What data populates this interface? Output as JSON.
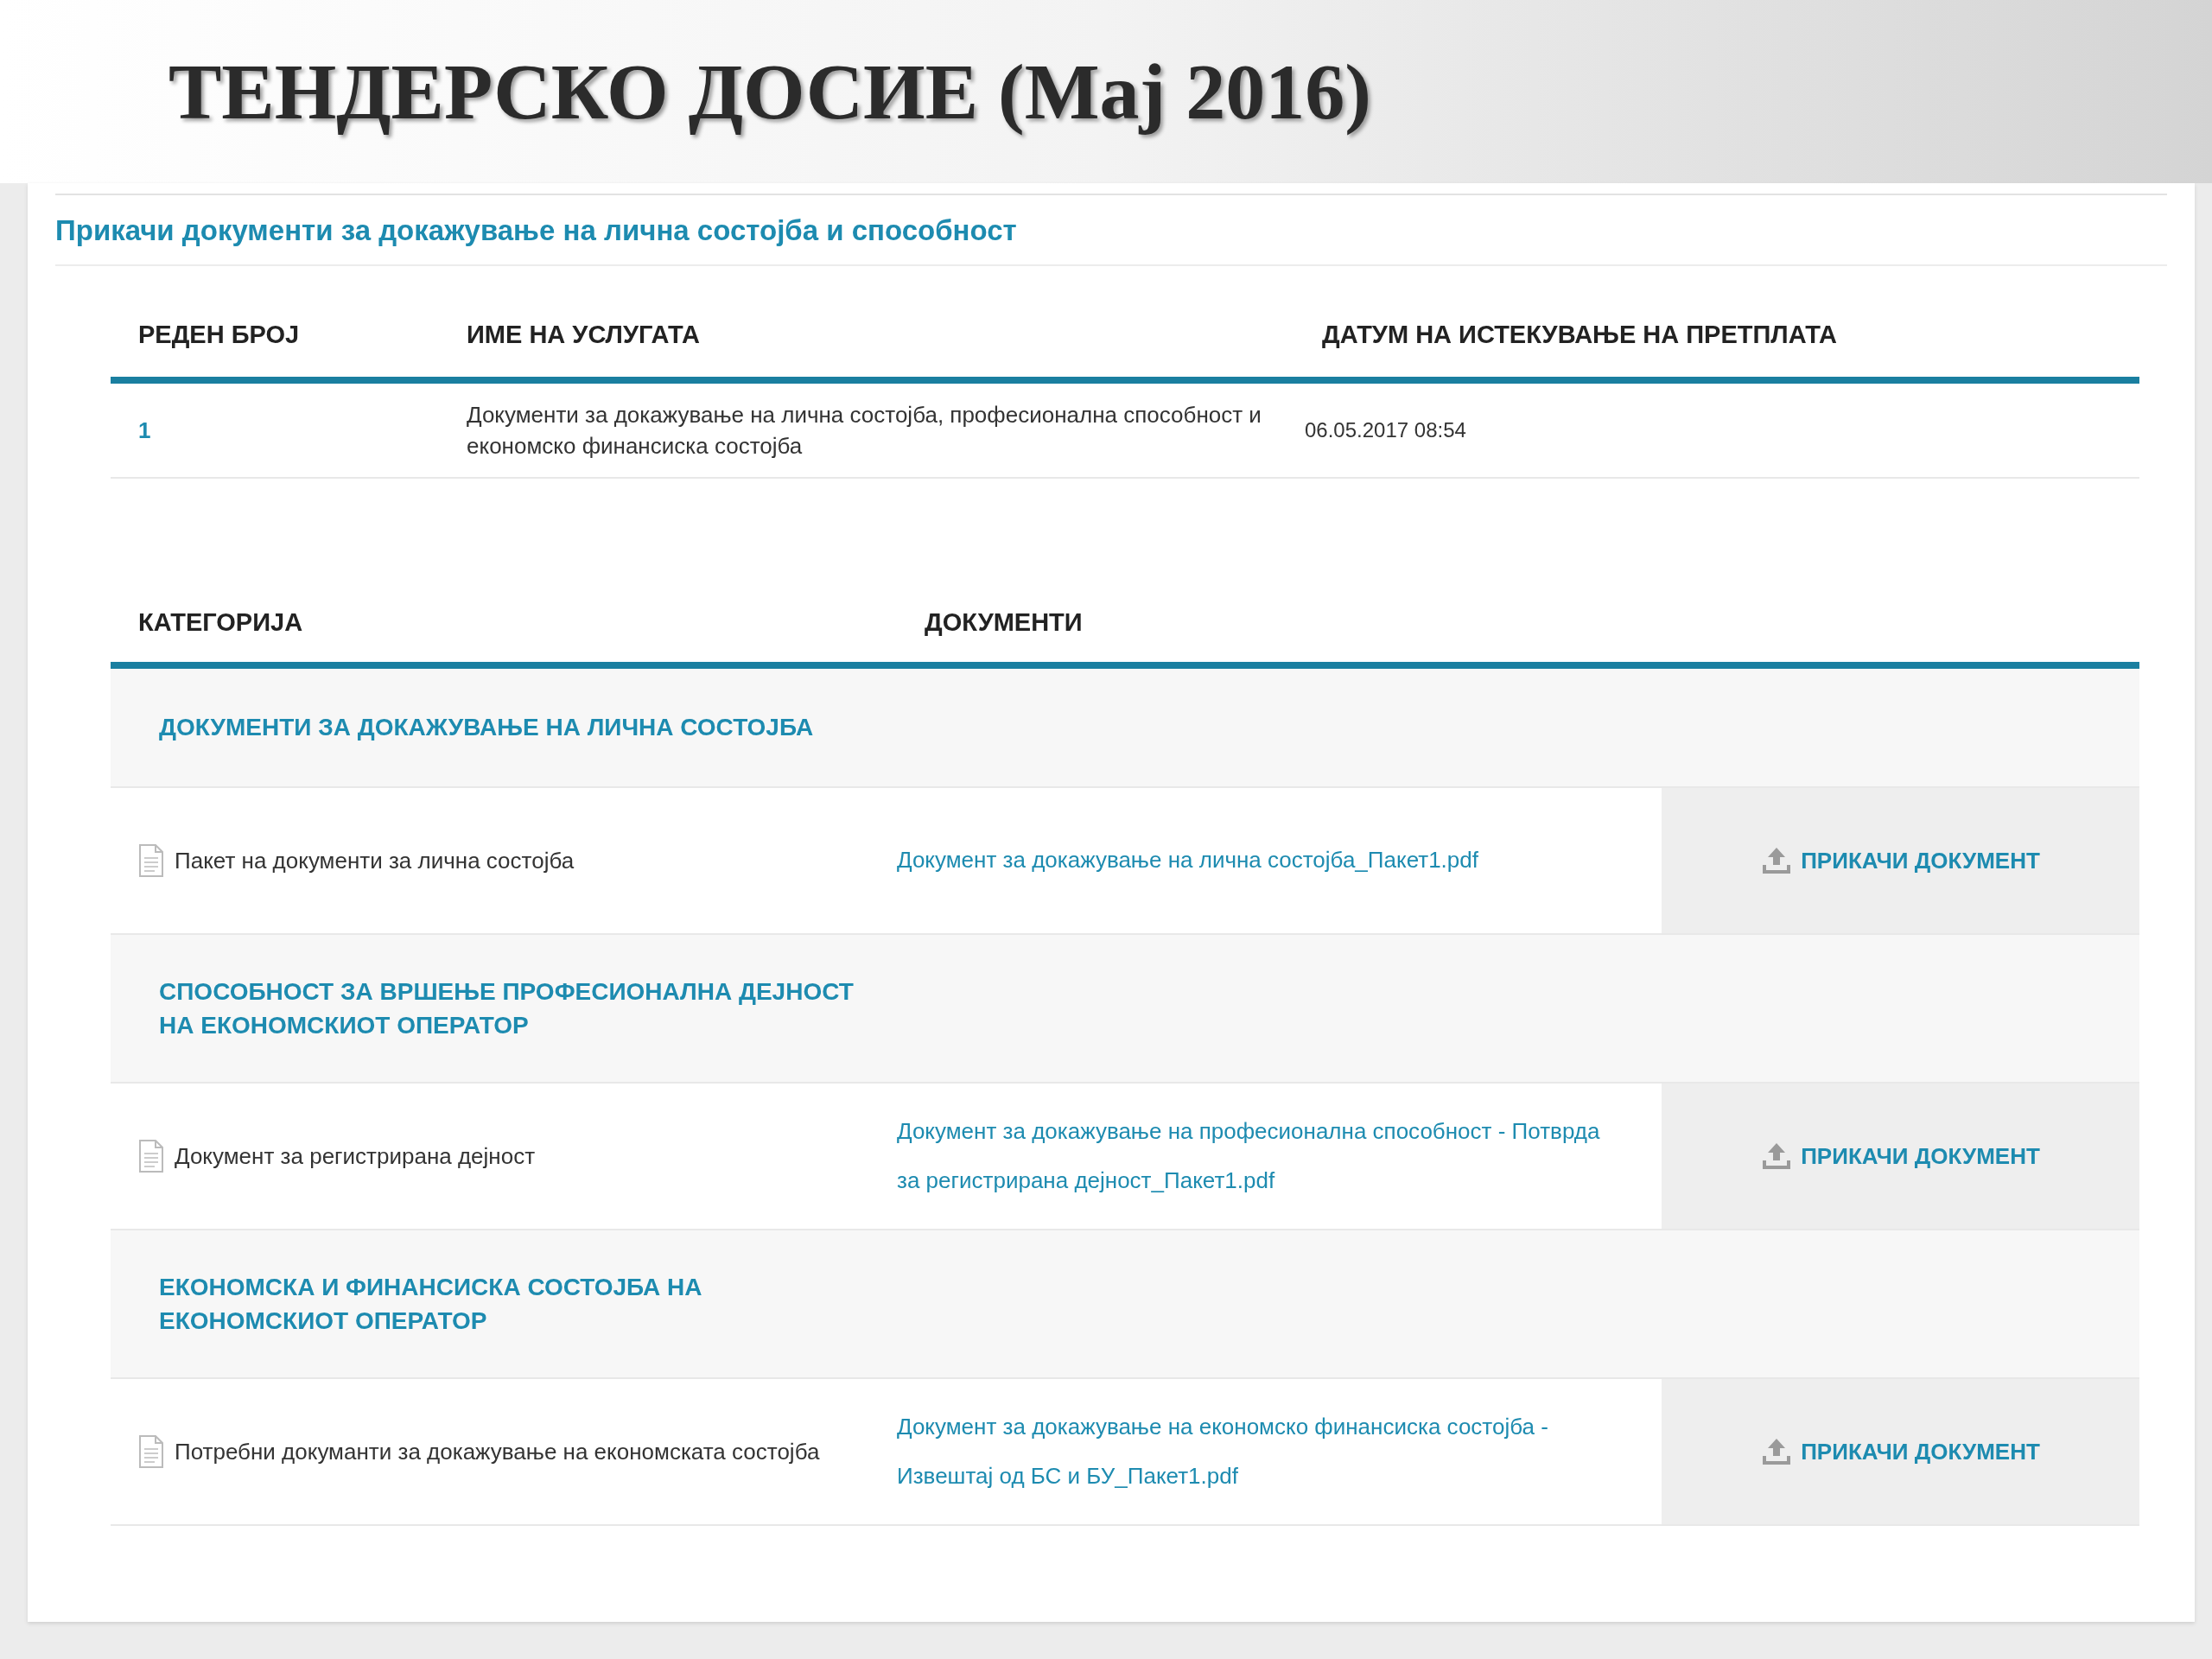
{
  "slide_title": "ТЕНДЕРСКО ДОСИЕ (Мај 2016)",
  "panel": {
    "heading": "Прикачи документи за докажување на лична состојба и способност",
    "services_table": {
      "columns": [
        "РЕДЕН БРОЈ",
        "ИМЕ НА УСЛУГАТА",
        "ДАТУМ НА ИСТЕКУВАЊЕ НА ПРЕТПЛАТА"
      ],
      "rows": [
        {
          "number": "1",
          "service": "Документи за докажување на лична состојба, професионална способност и економско финансиска состојба",
          "expiry": "06.05.2017 08:54"
        }
      ]
    },
    "documents_table": {
      "columns": [
        "КАТЕГОРИЈА",
        "ДОКУМЕНТИ"
      ],
      "groups": [
        {
          "category": "ДОКУМЕНТИ ЗА ДОКАЖУВАЊЕ НА ЛИЧНА СОСТОЈБА",
          "items": [
            {
              "name": "Пакет на документи за лична состојба",
              "file": "Документ за докажување на лична состојба_Пакет1.pdf",
              "action": "ПРИКАЧИ ДОКУМЕНТ"
            }
          ]
        },
        {
          "category": "СПОСОБНОСТ ЗА ВРШЕЊЕ ПРОФЕСИОНАЛНА ДЕЈНОСТ НА ЕКОНОМСКИОТ ОПЕРАТОР",
          "items": [
            {
              "name": "Документ за регистрирана дејност",
              "file": "Документ за докажување на професионална способност - Потврда за регистрирана дејност_Пакет1.pdf",
              "action": "ПРИКАЧИ ДОКУМЕНТ"
            }
          ]
        },
        {
          "category": "ЕКОНОМСКА И ФИНАНСИСКА СОСТОЈБА НА ЕКОНОМСКИОТ ОПЕРАТОР",
          "items": [
            {
              "name": "Потребни докуманти за докажување на економската состојба",
              "file": "Документ за докажување на економско финансиска состојба - Извештај од БС и БУ_Пакет1.pdf",
              "action": "ПРИКАЧИ ДОКУМЕНТ"
            }
          ]
        }
      ]
    }
  }
}
